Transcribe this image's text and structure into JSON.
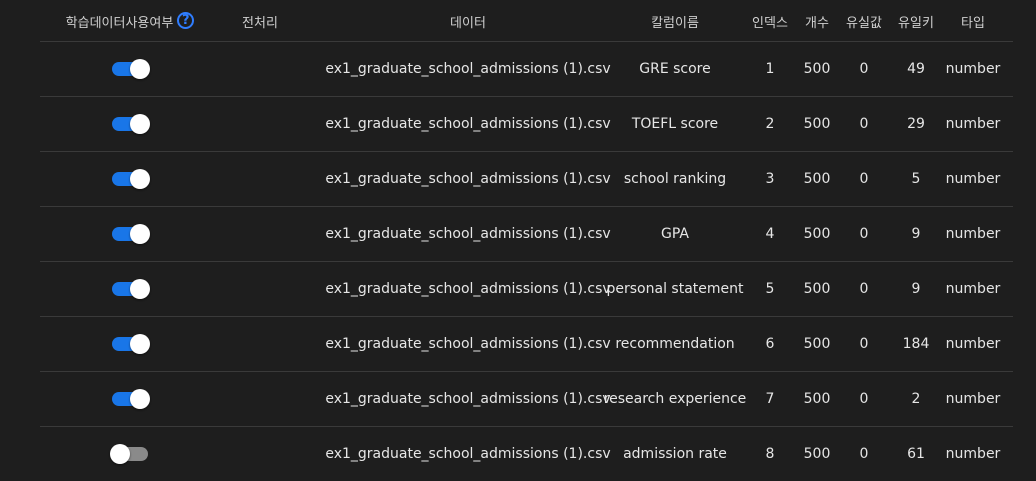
{
  "header": {
    "use_training_data": "학습데이터사용여부",
    "help_icon": "?",
    "preprocessing": "전처리",
    "data": "데이터",
    "column_name": "칼럼이름",
    "index": "인덱스",
    "count": "개수",
    "missing": "유실값",
    "unique": "유일키",
    "type": "타입"
  },
  "rows": [
    {
      "enabled": true,
      "preprocessing": "",
      "data": "ex1_graduate_school_admissions (1).csv",
      "column": "GRE score",
      "index": "1",
      "count": "500",
      "missing": "0",
      "unique": "49",
      "type": "number"
    },
    {
      "enabled": true,
      "preprocessing": "",
      "data": "ex1_graduate_school_admissions (1).csv",
      "column": "TOEFL score",
      "index": "2",
      "count": "500",
      "missing": "0",
      "unique": "29",
      "type": "number"
    },
    {
      "enabled": true,
      "preprocessing": "",
      "data": "ex1_graduate_school_admissions (1).csv",
      "column": "school ranking",
      "index": "3",
      "count": "500",
      "missing": "0",
      "unique": "5",
      "type": "number"
    },
    {
      "enabled": true,
      "preprocessing": "",
      "data": "ex1_graduate_school_admissions (1).csv",
      "column": "GPA",
      "index": "4",
      "count": "500",
      "missing": "0",
      "unique": "9",
      "type": "number"
    },
    {
      "enabled": true,
      "preprocessing": "",
      "data": "ex1_graduate_school_admissions (1).csv",
      "column": "personal statement",
      "index": "5",
      "count": "500",
      "missing": "0",
      "unique": "9",
      "type": "number"
    },
    {
      "enabled": true,
      "preprocessing": "",
      "data": "ex1_graduate_school_admissions (1).csv",
      "column": "recommendation",
      "index": "6",
      "count": "500",
      "missing": "0",
      "unique": "184",
      "type": "number"
    },
    {
      "enabled": true,
      "preprocessing": "",
      "data": "ex1_graduate_school_admissions (1).csv",
      "column": "research experience",
      "index": "7",
      "count": "500",
      "missing": "0",
      "unique": "2",
      "type": "number"
    },
    {
      "enabled": false,
      "preprocessing": "",
      "data": "ex1_graduate_school_admissions (1).csv",
      "column": "admission rate",
      "index": "8",
      "count": "500",
      "missing": "0",
      "unique": "61",
      "type": "number"
    }
  ],
  "colors": {
    "background": "#1e1e1e",
    "toggle_on": "#1976e8",
    "toggle_off": "#8a8a8a",
    "help_icon": "#2f7dff",
    "divider": "#3a3a3a"
  }
}
